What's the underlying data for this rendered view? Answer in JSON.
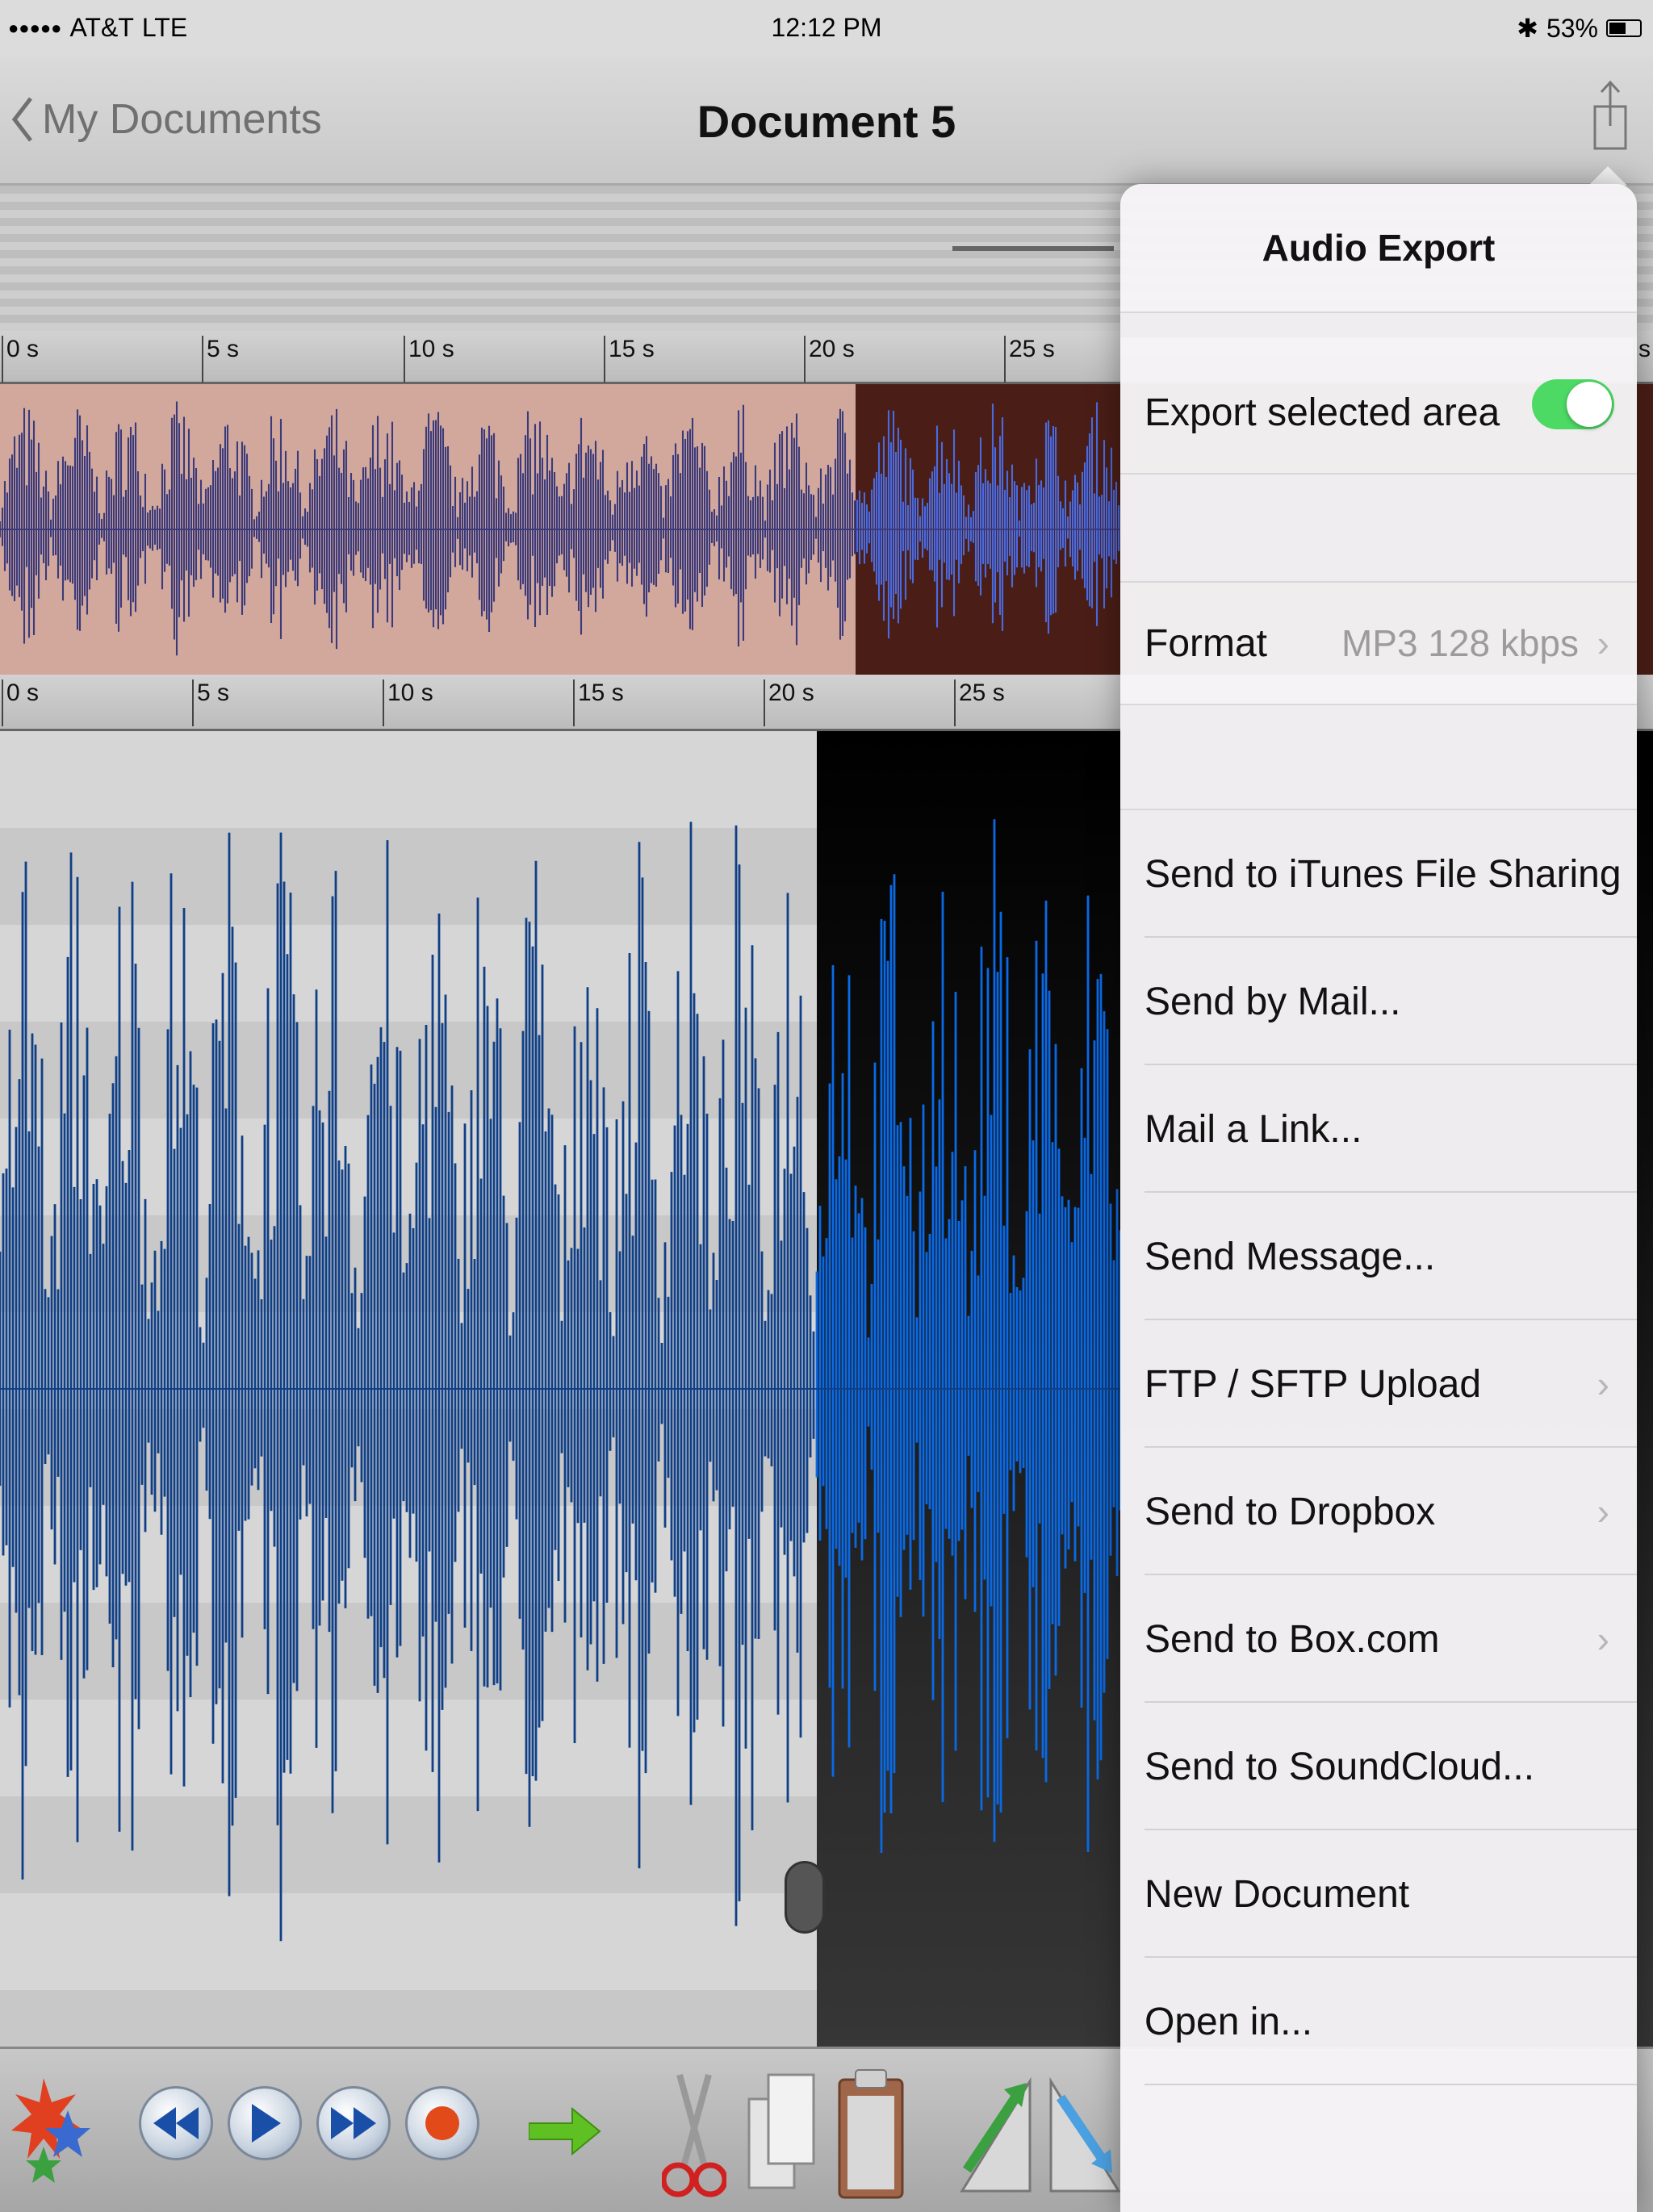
{
  "status_bar": {
    "signal": "●●●●●",
    "carrier": "AT&T",
    "network": "LTE",
    "time": "12:12 PM",
    "bluetooth": "✱",
    "battery_percent": "53%",
    "battery_level": 0.53
  },
  "nav": {
    "back_label": "My Documents",
    "title": "Document 5"
  },
  "timeline": {
    "overview_ticks": [
      "0 s",
      "5 s",
      "10 s",
      "15 s",
      "20 s",
      "25 s",
      "s"
    ],
    "detail_ticks": [
      "0 s",
      "5 s",
      "10 s",
      "15 s",
      "20 s",
      "25 s"
    ]
  },
  "popover": {
    "title": "Audio Export",
    "export_selected": {
      "label": "Export selected area",
      "on": true
    },
    "format": {
      "label": "Format",
      "value": "MP3 128 kbps"
    },
    "actions": [
      {
        "label": "Send to iTunes File Sharing",
        "chevron": false
      },
      {
        "label": "Send by Mail...",
        "chevron": false
      },
      {
        "label": "Mail a Link...",
        "chevron": false
      },
      {
        "label": "Send Message...",
        "chevron": false
      },
      {
        "label": "FTP / SFTP Upload",
        "chevron": true
      },
      {
        "label": "Send to Dropbox",
        "chevron": true
      },
      {
        "label": "Send to Box.com",
        "chevron": true
      },
      {
        "label": "Send to SoundCloud...",
        "chevron": false
      },
      {
        "label": "New Document",
        "chevron": false
      },
      {
        "label": "Open in...",
        "chevron": false
      }
    ],
    "chevron_glyph": "›"
  },
  "colors": {
    "wave_unselected": "#0f3f86",
    "wave_selected": "#0a6ae6",
    "overview_wave": "#3b3a7a",
    "overview_wave_selected": "#4a6ae0",
    "toggle_on": "#4cd964"
  },
  "icons": {
    "back": "chevron-left-icon",
    "share": "share-icon",
    "effects": "effects-burst-icon",
    "rewind": "rewind-icon",
    "play": "play-icon",
    "fast_forward": "fast-forward-icon",
    "record": "record-icon",
    "go_to": "arrow-right-icon",
    "cut": "scissors-icon",
    "copy": "copy-icon",
    "paste": "clipboard-icon",
    "fade_in": "fade-in-icon",
    "fade_out": "fade-out-icon"
  }
}
